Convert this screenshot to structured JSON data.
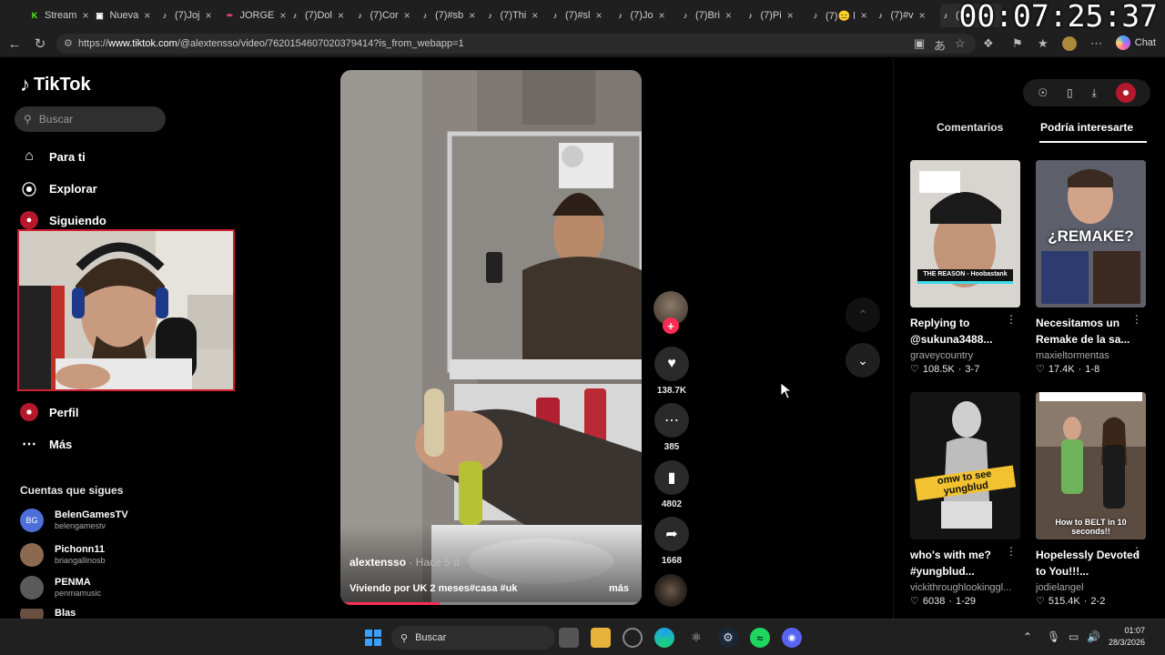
{
  "browser": {
    "tabs": [
      {
        "label": "Stream",
        "favicon": "kick-icon",
        "color": "#53fc18"
      },
      {
        "label": "Nueva",
        "favicon": "newtab-icon",
        "color": "#ffffff"
      },
      {
        "label": "(7)Joj",
        "favicon": "tiktok-icon",
        "color": "#ffffff"
      },
      {
        "label": "JORGE",
        "favicon": "feather-icon",
        "color": "#e0457b"
      },
      {
        "label": "(7)Dol",
        "favicon": "tiktok-icon",
        "color": "#ffffff"
      },
      {
        "label": "(7)Cor",
        "favicon": "tiktok-icon",
        "color": "#ffffff"
      },
      {
        "label": "(7)#sb",
        "favicon": "tiktok-icon",
        "color": "#ffffff"
      },
      {
        "label": "(7)Thi",
        "favicon": "tiktok-icon",
        "color": "#ffffff"
      },
      {
        "label": "(7)#sl",
        "favicon": "tiktok-icon",
        "color": "#ffffff"
      },
      {
        "label": "(7)Jo",
        "favicon": "tiktok-icon",
        "color": "#ffffff"
      },
      {
        "label": "(7)Bri",
        "favicon": "tiktok-icon",
        "color": "#ffffff"
      },
      {
        "label": "(7)Pi",
        "favicon": "tiktok-icon",
        "color": "#ffffff"
      },
      {
        "label": "(7)😑 l",
        "favicon": "tiktok-icon",
        "color": "#ffffff"
      },
      {
        "label": "(7)#v",
        "favicon": "tiktok-icon",
        "color": "#ffffff"
      },
      {
        "label": "(7",
        "favicon": "tiktok-icon",
        "color": "#ffffff"
      }
    ],
    "timer": "00:07:25:37",
    "url_prefix": "https://",
    "url_host": "www.tiktok.com",
    "url_rest": "/@alextensso/video/7620154607020379414?is_from_webapp=1",
    "chat_label": "Chat"
  },
  "sidebar": {
    "logo": "TikTok",
    "search_placeholder": "Buscar",
    "nav": [
      {
        "label": "Para ti",
        "icon": "home-icon"
      },
      {
        "label": "Explorar",
        "icon": "compass-icon"
      },
      {
        "label": "Siguiendo",
        "icon": "following-icon"
      },
      {
        "label": "Perfil",
        "icon": "profile-icon"
      },
      {
        "label": "Más",
        "icon": "more-icon"
      }
    ],
    "following_title": "Cuentas que sigues",
    "accounts": [
      {
        "name": "BelenGamesTV",
        "handle": "belengamestv",
        "color": "#4e6fd8"
      },
      {
        "name": "Pichonn11",
        "handle": "briangallinosb",
        "color": "#8c6a52"
      },
      {
        "name": "PENMA",
        "handle": "penmamusic",
        "color": "#5a5a5a"
      },
      {
        "name": "Blas",
        "handle": "",
        "color": "#6a5040"
      }
    ]
  },
  "video": {
    "username": "alextensso",
    "age": " · Hace 5 d",
    "description": "Viviendo por UK 2 meses#casa #uk",
    "more": "más",
    "progress": 0.33,
    "likes": "138.7K",
    "comments": "385",
    "saves": "4802",
    "shares": "1668"
  },
  "right_panel": {
    "tab_comments": "Comentarios",
    "tab_interest": "Podría interesarte",
    "cards": [
      {
        "title": "Replying to @sukuna3488...",
        "user": "graveycountry",
        "likes": "108.5K",
        "date": "3-7",
        "thumb_text": "THE REASON - Hoobastank"
      },
      {
        "title": "Necesitamos un Remake de la sa...",
        "user": "maxieltormentas",
        "likes": "17.4K",
        "date": "1-8",
        "thumb_text": "¿REMAKE?"
      },
      {
        "title": "who's with me? #yungblud...",
        "user": "vickithroughlookinggl...",
        "likes": "6038",
        "date": "1-29",
        "thumb_text": "omw to see yungblud"
      },
      {
        "title": "Hopelessly Devoted to You!!!...",
        "user": "jodielangel",
        "likes": "515.4K",
        "date": "2-2",
        "thumb_text": "How to BELT in 10 seconds!!"
      }
    ]
  },
  "taskbar": {
    "search_label": "Buscar",
    "time": "01:07",
    "date": "28/3/2026"
  }
}
